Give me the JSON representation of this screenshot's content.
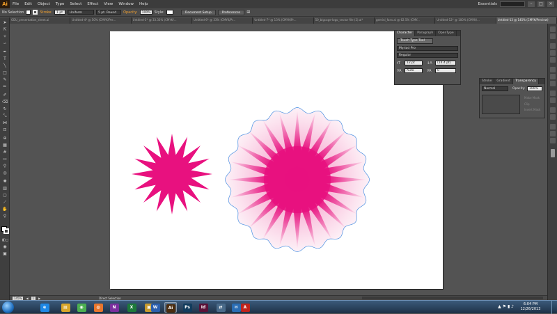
{
  "menubar": {
    "logo": "Ai",
    "items": [
      "File",
      "Edit",
      "Object",
      "Type",
      "Select",
      "Effect",
      "View",
      "Window",
      "Help"
    ],
    "workspace": "Essentials",
    "window_buttons": [
      "–",
      "□",
      "✕"
    ]
  },
  "controlbar": {
    "selection": "No Selection",
    "stroke_label": "Stroke:",
    "stroke_weight": "1 pt",
    "stroke_profile": "Uniform",
    "brush": "5 pt. Round",
    "opacity_label": "Opacity:",
    "opacity": "100%",
    "style_label": "Style:",
    "document_setup": "Document Setup",
    "preferences": "Preferences"
  },
  "tabs": [
    {
      "label": "GDU_presentation_sheet.ai",
      "active": false
    },
    {
      "label": "Untitled-4* @ 50% (CMYK/Pre...",
      "active": false
    },
    {
      "label": "Untitled-5* @ 33.33% (CMYK/...",
      "active": false
    },
    {
      "label": "Untitled-6* @ 33% (CMYK/Pr...",
      "active": false
    },
    {
      "label": "Untitled-7* @ 13% (CMYK/Pr...",
      "active": false
    },
    {
      "label": "50_bigcage-logo_vector file (2).ai*",
      "active": false
    },
    {
      "label": "gemini_fans.ai @ 62.5% (CMY...",
      "active": false
    },
    {
      "label": "Untitled-12* @ 100% (CMYK/...",
      "active": false
    },
    {
      "label": "Untitled-13 @ 145% (CMYK/Preview)",
      "active": true
    }
  ],
  "character_panel": {
    "tabs": [
      "Character",
      "Paragraph",
      "OpenType"
    ],
    "touch_type_tool": "Touch Type Tool",
    "font_family": "Myriad Pro",
    "font_style": "Regular",
    "font_size": "12 pt",
    "leading": "(14.4 pt)",
    "kerning": "Auto",
    "tracking": "0"
  },
  "transparency_panel": {
    "tabs": [
      "Stroke",
      "Gradient",
      "Transparency"
    ],
    "blend_mode": "Normal",
    "opacity_label": "Opacity:",
    "opacity": "100%",
    "make_mask": "Make Mask",
    "clip": "Clip",
    "invert_mask": "Invert Mask"
  },
  "statusbar": {
    "zoom": "145%",
    "page": "1",
    "tool": "Direct Selection"
  },
  "taskbar": {
    "apps": [
      {
        "name": "ie-icon",
        "label": "e",
        "color": "#1e88e5",
        "running": false
      },
      {
        "name": "explorer-icon",
        "label": "▤",
        "color": "#d8a62a",
        "running": false
      },
      {
        "name": "chrome-icon",
        "label": "◉",
        "color": "#4caf50",
        "running": false
      },
      {
        "name": "firefox-icon",
        "label": "◍",
        "color": "#e8762d",
        "running": false
      },
      {
        "name": "onenote-icon",
        "label": "N",
        "color": "#7b2f9e",
        "running": false
      },
      {
        "name": "excel-icon",
        "label": "X",
        "color": "#1d7a3a",
        "running": false
      },
      {
        "name": "folder-icon",
        "label": "▣",
        "color": "#c79a2e",
        "running": false
      },
      {
        "name": "word-icon",
        "label": "W",
        "color": "#2b5fad",
        "running": false
      },
      {
        "name": "illustrator-icon",
        "label": "Ai",
        "color": "#4a2c0f",
        "running": true
      },
      {
        "name": "photoshop-icon",
        "label": "Ps",
        "color": "#123c5d",
        "running": false
      },
      {
        "name": "indesign-icon",
        "label": "Id",
        "color": "#5b1238",
        "running": false
      },
      {
        "name": "network-icon",
        "label": "⇄",
        "color": "#4a6b8a",
        "running": false
      },
      {
        "name": "outlook-icon",
        "label": "✉",
        "color": "#2a6db4",
        "running": false
      },
      {
        "name": "acrobat-icon",
        "label": "A",
        "color": "#c0231c",
        "running": false
      }
    ],
    "time": "6:04 PM",
    "date": "12/26/2013"
  },
  "colors": {
    "magenta": "#e8117f",
    "path_outline": "#4a90e2"
  }
}
